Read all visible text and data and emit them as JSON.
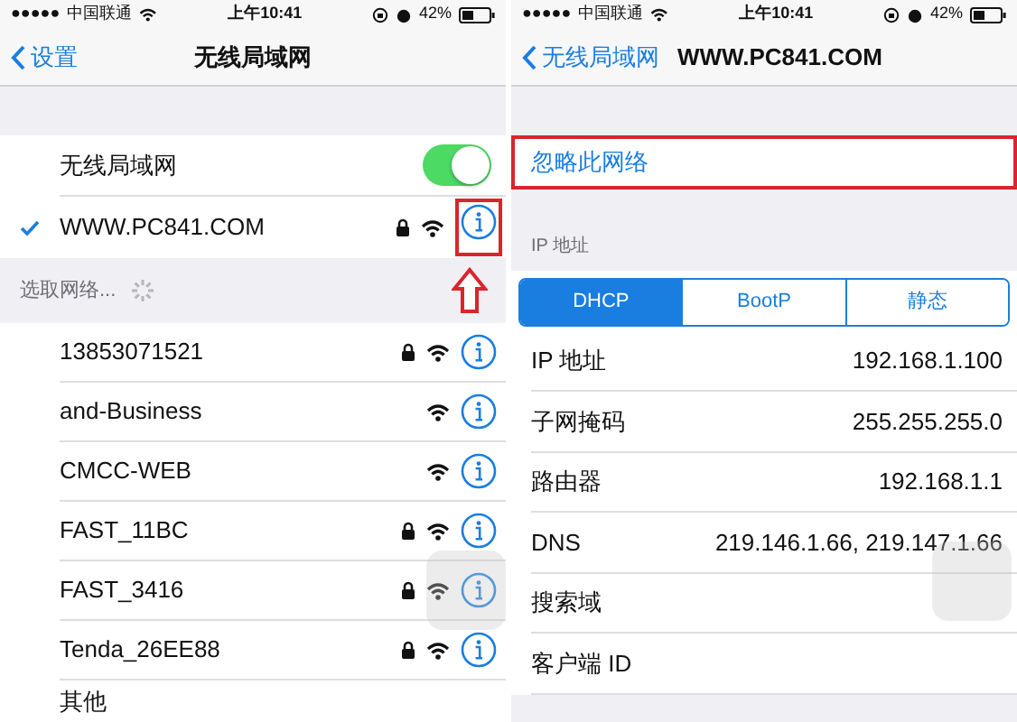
{
  "left_screen": {
    "status_bar": {
      "signal": "●●●●●",
      "carrier": "中国联通",
      "time": "上午10:41",
      "battery": "42%"
    },
    "nav": {
      "back": "设置",
      "title": "无线局域网"
    },
    "wifi_toggle": {
      "label": "无线局域网",
      "on": true
    },
    "connected": {
      "name": "WWW.PC841.COM",
      "checked": true,
      "locked": true,
      "info_highlighted": true
    },
    "section_header": "选取网络...",
    "networks": [
      {
        "name": "13853071521",
        "locked": true
      },
      {
        "name": "and-Business",
        "locked": false
      },
      {
        "name": "CMCC-WEB",
        "locked": false
      },
      {
        "name": "FAST_11BC",
        "locked": true
      },
      {
        "name": "FAST_3416",
        "locked": true
      },
      {
        "name": "Tenda_26EE88",
        "locked": true
      }
    ],
    "other": "其他"
  },
  "right_screen": {
    "status_bar": {
      "signal": "●●●●●",
      "carrier": "中国联通",
      "time": "上午10:41",
      "battery": "42%"
    },
    "nav": {
      "back": "无线局域网",
      "title": "WWW.PC841.COM"
    },
    "forget": {
      "label": "忽略此网络",
      "highlighted": true
    },
    "section_header": "IP 地址",
    "segments": [
      {
        "label": "DHCP",
        "selected": true
      },
      {
        "label": "BootP",
        "selected": false
      },
      {
        "label": "静态",
        "selected": false
      }
    ],
    "rows": [
      {
        "label": "IP 地址",
        "value": "192.168.1.100"
      },
      {
        "label": "子网掩码",
        "value": "255.255.255.0"
      },
      {
        "label": "路由器",
        "value": "192.168.1.1"
      },
      {
        "label": "DNS",
        "value": "219.146.1.66, 219.147.1.66"
      },
      {
        "label": "搜索域"
      },
      {
        "label": "客户端 ID"
      }
    ]
  }
}
